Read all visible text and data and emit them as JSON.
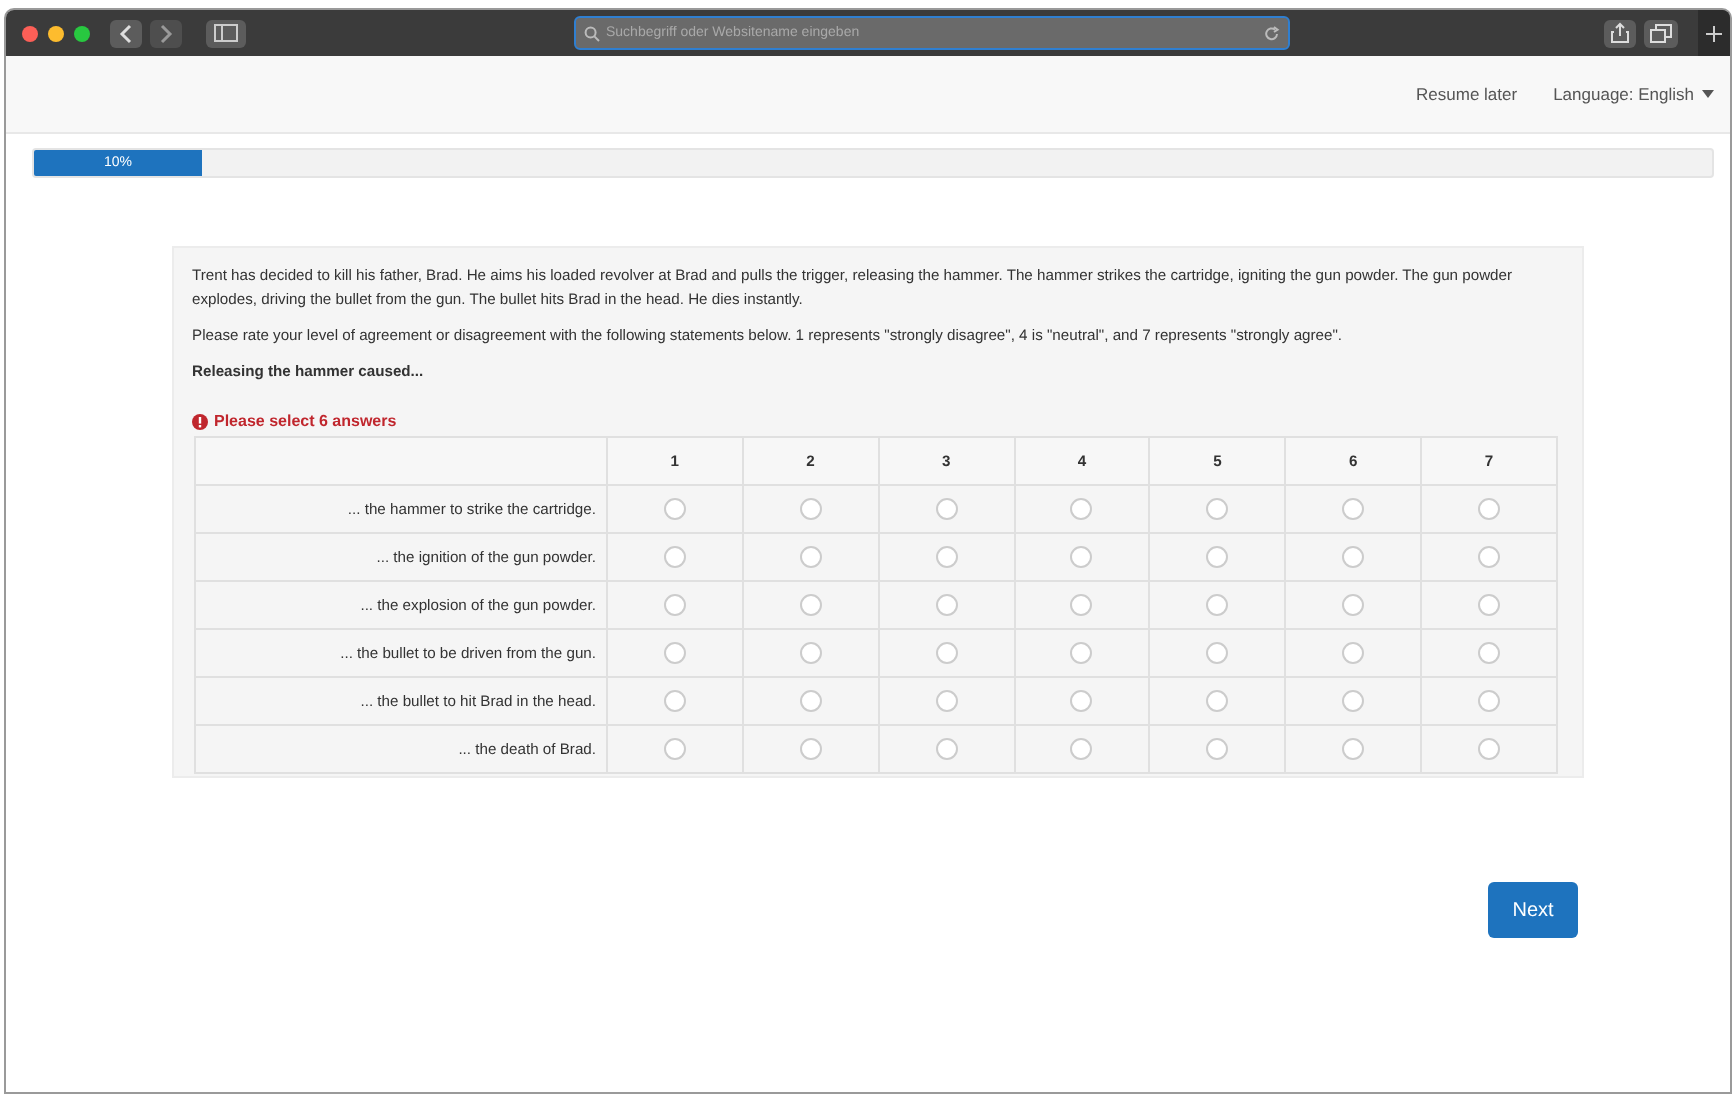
{
  "browser": {
    "address_placeholder": "Suchbegriff oder Websitename eingeben"
  },
  "header": {
    "resume": "Resume later",
    "language": "Language: English"
  },
  "progress": {
    "label": "10%",
    "level": 0.1
  },
  "question": {
    "story": "Trent has decided to kill his father, Brad. He aims his loaded revolver at Brad and pulls the trigger, releasing the hammer. The hammer strikes the cartridge, igniting the gun powder. The gun powder explodes, driving the bullet from the gun. The bullet hits Brad in the head. He dies instantly.",
    "instruction": "Please rate your level of agreement or disagreement with the following statements below. 1 represents \"strongly disagree\", 4 is \"neutral\", and 7 represents \"strongly agree\".",
    "prompt": "Releasing the hammer caused...",
    "error": "Please select 6 answers",
    "columns": [
      "1",
      "2",
      "3",
      "4",
      "5",
      "6",
      "7"
    ],
    "rows": [
      {
        "label": "... the hammer to strike the cartridge.",
        "checked": [
          false,
          false,
          false,
          false,
          false,
          false,
          false
        ]
      },
      {
        "label": "... the ignition of the gun powder.",
        "checked": [
          false,
          false,
          false,
          false,
          false,
          false,
          false
        ]
      },
      {
        "label": "... the explosion of the gun powder.",
        "checked": [
          false,
          false,
          false,
          false,
          false,
          false,
          false
        ]
      },
      {
        "label": "... the bullet to be driven from the gun.",
        "checked": [
          false,
          false,
          false,
          false,
          false,
          false,
          false
        ]
      },
      {
        "label": "... the bullet to hit Brad in the head.",
        "checked": [
          false,
          false,
          false,
          false,
          false,
          false,
          false
        ]
      },
      {
        "label": "... the death of Brad.",
        "checked": [
          false,
          false,
          false,
          false,
          false,
          false,
          false
        ]
      }
    ]
  },
  "next_button": "Next"
}
